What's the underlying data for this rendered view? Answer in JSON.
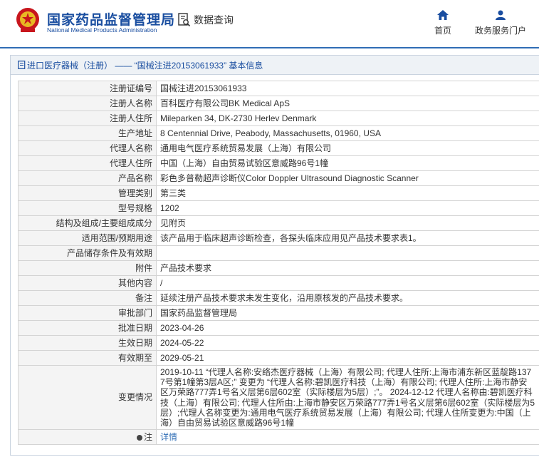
{
  "header": {
    "brand_cn": "国家药品监督管理局",
    "brand_en": "National Medical Products Administration",
    "data_query": "数据查询",
    "nav": [
      {
        "label": "首页",
        "icon": "home-icon"
      },
      {
        "label": "政务服务门户",
        "icon": "user-icon"
      }
    ]
  },
  "colors": {
    "brand": "#1a4ea0",
    "divider": "#2f6db5",
    "label_bg": "#f4f4f4"
  },
  "panel": {
    "title": "进口医疗器械（注册） —— “国械注进20153061933” 基本信息"
  },
  "rows": [
    {
      "key": "注册证编号",
      "value": "国械注进20153061933"
    },
    {
      "key": "注册人名称",
      "value": "百科医疗有限公司BK Medical ApS"
    },
    {
      "key": "注册人住所",
      "value": "Mileparken 34, DK-2730 Herlev Denmark"
    },
    {
      "key": "生产地址",
      "value": "8 Centennial Drive, Peabody, Massachusetts, 01960, USA"
    },
    {
      "key": "代理人名称",
      "value": "通用电气医疗系统贸易发展（上海）有限公司"
    },
    {
      "key": "代理人住所",
      "value": "中国（上海）自由贸易试验区意威路96号1幢"
    },
    {
      "key": "产品名称",
      "value": "彩色多普勒超声诊断仪Color Doppler Ultrasound Diagnostic Scanner"
    },
    {
      "key": "管理类别",
      "value": "第三类"
    },
    {
      "key": "型号规格",
      "value": "1202"
    },
    {
      "key": "结构及组成/主要组成成分",
      "value": "见附页"
    },
    {
      "key": "适用范围/预期用途",
      "value": "该产品用于临床超声诊断检查，各探头临床应用见产品技术要求表1。"
    },
    {
      "key": "产品储存条件及有效期",
      "value": ""
    },
    {
      "key": "附件",
      "value": "产品技术要求"
    },
    {
      "key": "其他内容",
      "value": "/"
    },
    {
      "key": "备注",
      "value": "延续注册产品技术要求未发生变化，沿用原核发的产品技术要求。"
    },
    {
      "key": "审批部门",
      "value": "国家药品监督管理局"
    },
    {
      "key": "批准日期",
      "value": "2023-04-26"
    },
    {
      "key": "生效日期",
      "value": "2024-05-22"
    },
    {
      "key": "有效期至",
      "value": "2029-05-21"
    }
  ],
  "changes": {
    "key": "变更情况",
    "value": "2019-10-11 “代理人名称:安络杰医疗器械（上海）有限公司; 代理人住所:上海市浦东新区蓝靛路1377号第1幢第3层A区;” 变更为 “代理人名称:碧凯医疗科技（上海）有限公司; 代理人住所:上海市静安区万荣路777弄1号名义层第6层602室（实际楼层为5层）;”。 2024-12-12 代理人名称由:碧凯医疗科技（上海）有限公司; 代理人住所由:上海市静安区万荣路777弄1号名义层第6层602室（实际楼层为5层）;代理人名称变更为:通用电气医疗系统贸易发展（上海）有限公司; 代理人住所变更为:中国（上海）自由贸易试验区意威路96号1幢"
  },
  "note": {
    "key": "注",
    "value": "详情",
    "icon": "bullet-icon"
  }
}
